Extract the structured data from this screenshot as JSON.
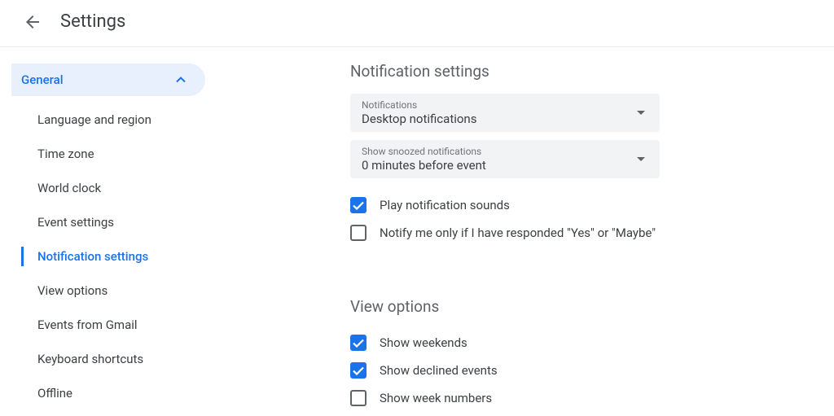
{
  "header": {
    "title": "Settings"
  },
  "sidebar": {
    "group_label": "General",
    "items": [
      "Language and region",
      "Time zone",
      "World clock",
      "Event settings",
      "Notification settings",
      "View options",
      "Events from Gmail",
      "Keyboard shortcuts",
      "Offline"
    ],
    "active_index": 4
  },
  "notification_section": {
    "title": "Notification settings",
    "dropdown1": {
      "label": "Notifications",
      "value": "Desktop notifications"
    },
    "dropdown2": {
      "label": "Show snoozed notifications",
      "value": "0 minutes before event"
    },
    "check1": {
      "label": "Play notification sounds",
      "checked": true
    },
    "check2": {
      "label": "Notify me only if I have responded \"Yes\" or \"Maybe\"",
      "checked": false
    }
  },
  "view_section": {
    "title": "View options",
    "check1": {
      "label": "Show weekends",
      "checked": true
    },
    "check2": {
      "label": "Show declined events",
      "checked": true
    },
    "check3": {
      "label": "Show week numbers",
      "checked": false
    }
  }
}
